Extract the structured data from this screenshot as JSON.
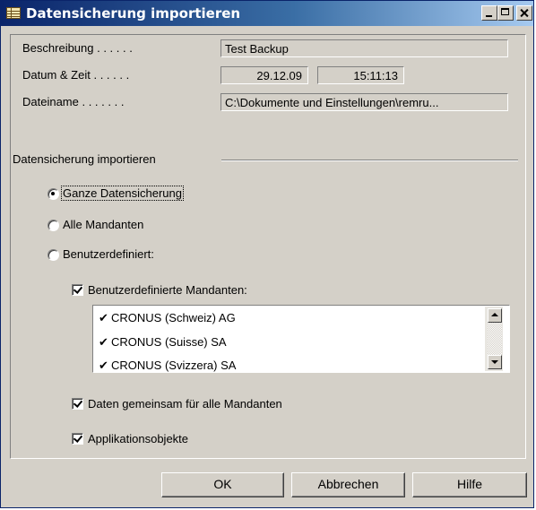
{
  "window": {
    "title": "Datensicherung importieren"
  },
  "info": {
    "beschreibung_label": "Beschreibung . . . . . .",
    "beschreibung_value": "Test Backup",
    "datum_label": "Datum & Zeit . . . . . .",
    "datum_value": "29.12.09",
    "zeit_value": "15:11:13",
    "dateiname_label": "Dateiname . . . . . . .",
    "dateiname_value": "C:\\Dokumente und Einstellungen\\remru..."
  },
  "import": {
    "group_label": "Datensicherung importieren",
    "options": [
      {
        "label": "Ganze Datensicherung",
        "selected": true
      },
      {
        "label": "Alle Mandanten",
        "selected": false
      },
      {
        "label": "Benutzerdefiniert:",
        "selected": false
      }
    ],
    "custom_companies_label": "Benutzerdefinierte Mandanten:",
    "custom_companies_checked": true,
    "companies": [
      {
        "name": "CRONUS (Schweiz) AG",
        "checked": true
      },
      {
        "name": "CRONUS (Suisse) SA",
        "checked": true
      },
      {
        "name": "CRONUS (Svizzera) SA",
        "checked": true
      }
    ],
    "shared_data_label": "Daten gemeinsam für alle Mandanten",
    "shared_data_checked": true,
    "app_objects_label": "Applikationsobjekte",
    "app_objects_checked": true
  },
  "buttons": {
    "ok": "OK",
    "cancel": "Abbrechen",
    "help": "Hilfe"
  },
  "icons": {
    "title": "table-icon",
    "list_check": "✔"
  }
}
